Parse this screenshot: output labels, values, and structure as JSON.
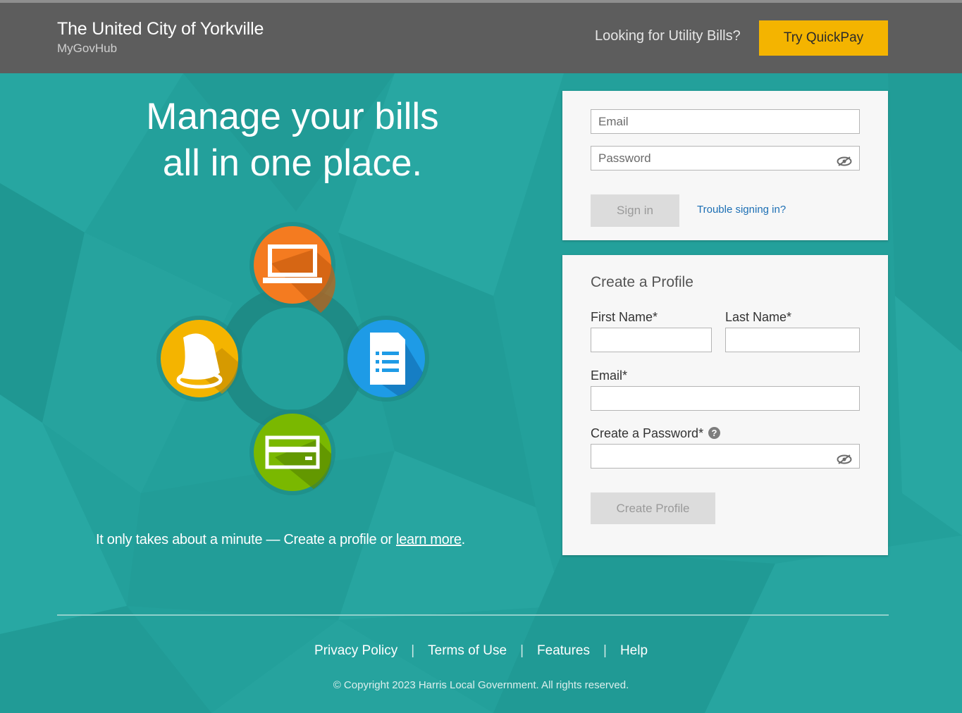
{
  "colors": {
    "background": "#23a09b",
    "header": "#5d5d5d",
    "quickpay": "#f4b400",
    "link": "#1c6fb4",
    "icon_orange": "#f47b20",
    "icon_blue": "#1e9be6",
    "icon_yellow": "#f4b400",
    "icon_green": "#7ab800"
  },
  "header": {
    "title": "The United City of Yorkville",
    "subtitle": "MyGovHub",
    "utility_question": "Looking for Utility Bills?",
    "quickpay_label": "Try QuickPay"
  },
  "hero": {
    "line1": "Manage your bills",
    "line2": "all in one place.",
    "tagline_prefix": "It only takes about a minute — Create a profile or ",
    "learn_more": "learn more",
    "tagline_suffix": ".",
    "icons": [
      "laptop-icon",
      "document-icon",
      "credit-card-icon",
      "bell-icon"
    ]
  },
  "signin": {
    "email_placeholder": "Email",
    "password_placeholder": "Password",
    "signin_label": "Sign in",
    "trouble_label": "Trouble signing in?"
  },
  "create_profile": {
    "title": "Create a Profile",
    "first_name_label": "First Name*",
    "last_name_label": "Last Name*",
    "email_label": "Email*",
    "password_label": "Create a Password*",
    "submit_label": "Create Profile"
  },
  "footer": {
    "links": [
      "Privacy Policy",
      "Terms of Use",
      "Features",
      "Help"
    ],
    "separator": "|",
    "copyright": "© Copyright 2023 Harris Local Government. All rights reserved."
  }
}
